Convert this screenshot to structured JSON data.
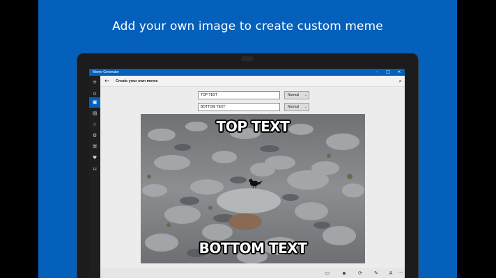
{
  "promo": {
    "headline": "Add your own image to create custom meme"
  },
  "app": {
    "title": "Meme Generator",
    "window_controls": {
      "minimize": "–",
      "maximize": "□",
      "close": "×"
    }
  },
  "sidebar": {
    "items": [
      {
        "icon": "hamburger-menu-icon",
        "glyph": "≡"
      },
      {
        "icon": "home-icon",
        "glyph": "⌂"
      },
      {
        "icon": "meme-editor-icon",
        "glyph": "▣",
        "active": true
      },
      {
        "icon": "gallery-icon",
        "glyph": "▤"
      },
      {
        "icon": "favorites-icon",
        "glyph": "☆"
      },
      {
        "icon": "settings-icon",
        "glyph": "⚙"
      },
      {
        "icon": "translate-icon",
        "glyph": "⌘"
      },
      {
        "icon": "like-icon",
        "glyph": "♥"
      },
      {
        "icon": "cart-icon",
        "glyph": "⊔"
      }
    ]
  },
  "header": {
    "back_glyph": "←",
    "title": "Create your own meme",
    "search_glyph": "⌕"
  },
  "editor": {
    "top_text": {
      "value": "TOP TEXT",
      "size": "Normal"
    },
    "bottom_text": {
      "value": "BOTTOM TEXT",
      "size": "Normal"
    }
  },
  "meme": {
    "top_caption": "TOP TEXT",
    "bottom_caption": "BOTTOM TEXT"
  },
  "commands": [
    {
      "icon": "open-folder-icon",
      "glyph": "▭"
    },
    {
      "icon": "save-icon",
      "glyph": "▪"
    },
    {
      "icon": "share-icon",
      "glyph": "⟳"
    },
    {
      "icon": "pen-icon",
      "glyph": "✎"
    },
    {
      "icon": "font-icon",
      "glyph": "A"
    },
    {
      "icon": "more-icon",
      "glyph": "···"
    }
  ]
}
